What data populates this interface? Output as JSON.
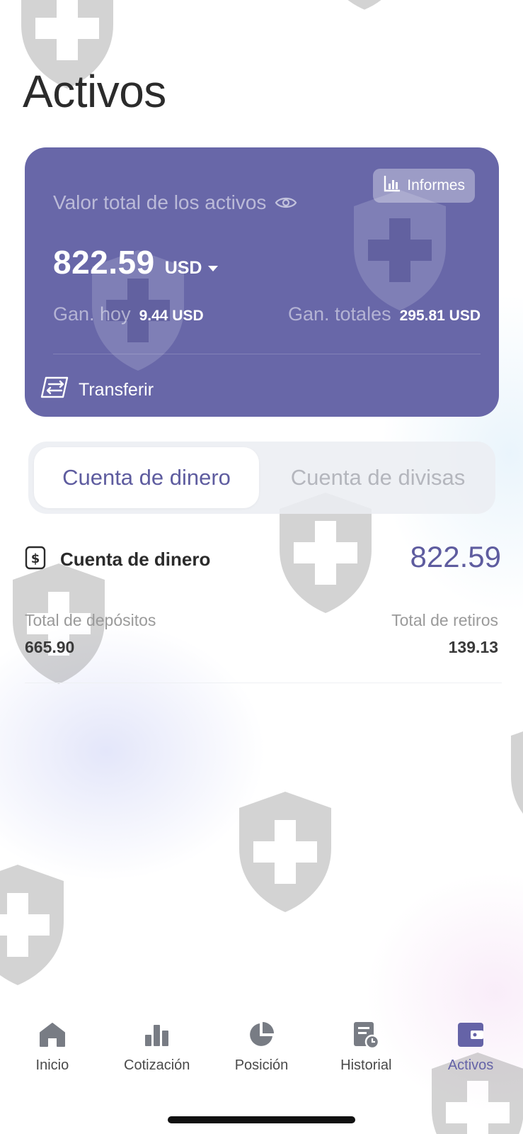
{
  "page": {
    "title": "Activos"
  },
  "summary_card": {
    "label": "Valor total de los activos",
    "reports_label": "Informes",
    "total_value": "822.59",
    "currency": "USD",
    "gain_today_label": "Gan. hoy",
    "gain_today_value": "9.44 USD",
    "gain_total_label": "Gan. totales",
    "gain_total_value": "295.81 USD",
    "transfer_label": "Transferir"
  },
  "account_tabs": [
    {
      "label": "Cuenta de dinero",
      "active": true
    },
    {
      "label": "Cuenta de divisas",
      "active": false
    }
  ],
  "account": {
    "title": "Cuenta de dinero",
    "balance": "822.59",
    "deposits_label": "Total de depósitos",
    "deposits_value": "665.90",
    "withdrawals_label": "Total de retiros",
    "withdrawals_value": "139.13"
  },
  "tabbar": [
    {
      "label": "Inicio",
      "icon": "home-icon"
    },
    {
      "label": "Cotización",
      "icon": "bar-chart-icon"
    },
    {
      "label": "Posición",
      "icon": "pie-chart-icon"
    },
    {
      "label": "Historial",
      "icon": "history-icon"
    },
    {
      "label": "Activos",
      "icon": "wallet-icon",
      "active": true
    }
  ],
  "colors": {
    "accent": "#6563a7",
    "card_background": "#6867a8",
    "text_primary": "#2b2b2b",
    "text_muted": "#9a9a9a"
  }
}
